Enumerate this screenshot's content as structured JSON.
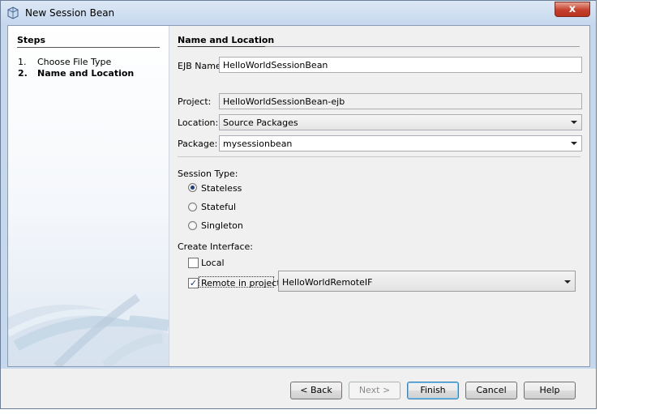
{
  "window": {
    "title": "New Session Bean",
    "close_label": "x"
  },
  "steps": {
    "title": "Steps",
    "items": [
      {
        "num": "1.",
        "label": "Choose File Type"
      },
      {
        "num": "2.",
        "label": "Name and Location"
      }
    ]
  },
  "form": {
    "section_title": "Name and Location",
    "ejb_name_label": "EJB Name:",
    "ejb_name_value": "HelloWorldSessionBean",
    "project_label": "Project:",
    "project_value": "HelloWorldSessionBean-ejb",
    "location_label": "Location:",
    "location_value": "Source Packages",
    "package_label": "Package:",
    "package_value": "mysessionbean",
    "session_type_label": "Session Type:",
    "session_types": [
      {
        "label": "Stateless",
        "selected": true
      },
      {
        "label": "Stateful",
        "selected": false
      },
      {
        "label": "Singleton",
        "selected": false
      }
    ],
    "create_interface_label": "Create Interface:",
    "local_label": "Local",
    "local_checked": false,
    "remote_label": "Remote in project:",
    "remote_checked": true,
    "remote_project_value": "HelloWorldRemoteIF"
  },
  "buttons": {
    "back": "< Back",
    "next": "Next >",
    "finish": "Finish",
    "cancel": "Cancel",
    "help": "Help"
  }
}
